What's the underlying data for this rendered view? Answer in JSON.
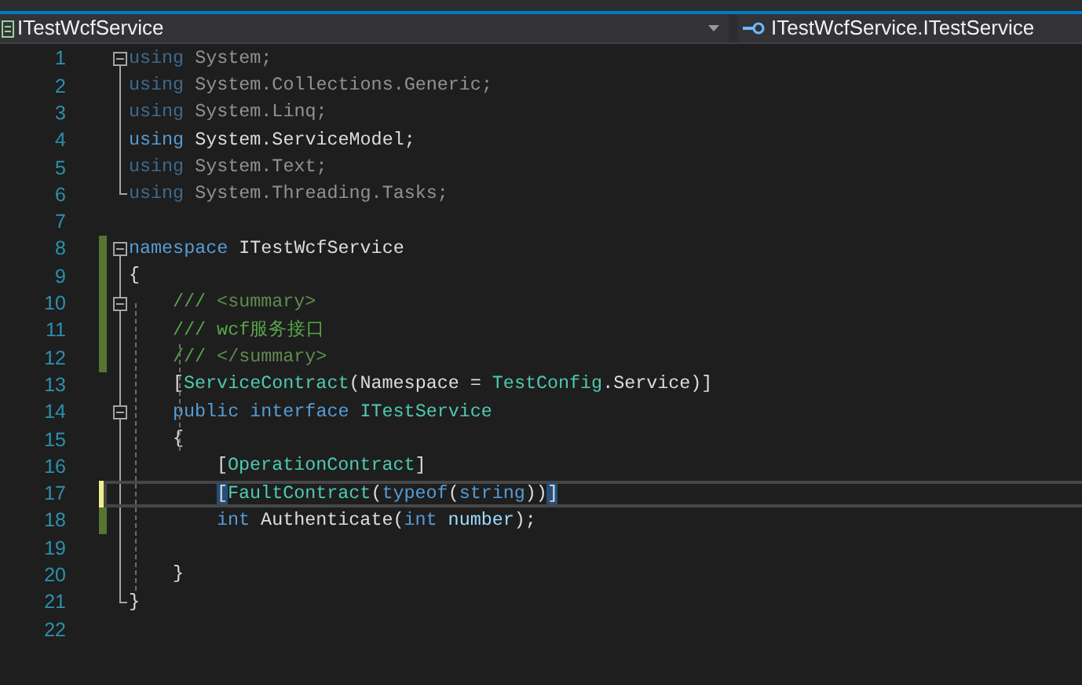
{
  "navigation_bar": {
    "project_dropdown": {
      "label": "ITestWcfService"
    },
    "member_dropdown": {
      "label": "ITestWcfService.ITestService"
    }
  },
  "editor": {
    "lines": [
      {
        "number": "1",
        "kind": "top",
        "modified": false,
        "fold_box": true,
        "outline": false,
        "outline_end": false,
        "unused": true,
        "current": false,
        "tokens": [
          {
            "text": "using",
            "kind": "keyword"
          },
          {
            "text": " System;",
            "kind": "plain"
          }
        ]
      },
      {
        "number": "2",
        "kind": "top",
        "modified": false,
        "fold_box": false,
        "outline": true,
        "outline_end": false,
        "unused": true,
        "current": false,
        "tokens": [
          {
            "text": "using",
            "kind": "keyword"
          },
          {
            "text": " System.Collections.Generic;",
            "kind": "plain"
          }
        ]
      },
      {
        "number": "3",
        "kind": "top",
        "modified": false,
        "fold_box": false,
        "outline": true,
        "outline_end": false,
        "unused": true,
        "current": false,
        "tokens": [
          {
            "text": "using",
            "kind": "keyword"
          },
          {
            "text": " System.Linq;",
            "kind": "plain"
          }
        ]
      },
      {
        "number": "4",
        "kind": "top",
        "modified": false,
        "fold_box": false,
        "outline": true,
        "outline_end": false,
        "unused": false,
        "current": false,
        "tokens": [
          {
            "text": "using",
            "kind": "keyword"
          },
          {
            "text": " System.ServiceModel;",
            "kind": "plain"
          }
        ]
      },
      {
        "number": "5",
        "kind": "top",
        "modified": false,
        "fold_box": false,
        "outline": true,
        "outline_end": false,
        "unused": true,
        "current": false,
        "tokens": [
          {
            "text": "using",
            "kind": "keyword"
          },
          {
            "text": " System.Text;",
            "kind": "plain"
          }
        ]
      },
      {
        "number": "6",
        "kind": "top",
        "modified": false,
        "fold_box": false,
        "outline": false,
        "outline_end": true,
        "unused": true,
        "current": false,
        "tokens": [
          {
            "text": "using",
            "kind": "keyword"
          },
          {
            "text": " System.Threading.Tasks;",
            "kind": "plain"
          }
        ]
      },
      {
        "number": "7",
        "modified": false,
        "fold_box": false,
        "outline": false,
        "outline_end": false,
        "current": false
      },
      {
        "number": "8",
        "kind": "top",
        "modified": true,
        "saved": true,
        "fold_box": true,
        "outline": false,
        "outline_end": false,
        "unused": false,
        "current": false,
        "tokens": [
          {
            "text": "namespace",
            "kind": "keyword"
          },
          {
            "text": " ITestWcfService",
            "kind": "plain"
          }
        ]
      },
      {
        "number": "9",
        "kind": "top",
        "modified": true,
        "saved": true,
        "fold_box": false,
        "outline": true,
        "outline_end": false,
        "unused": false,
        "current": false,
        "tokens": [
          {
            "text": "{",
            "kind": "plain"
          }
        ]
      },
      {
        "number": "10",
        "kind": "member",
        "modified": true,
        "saved": true,
        "fold_box": true,
        "outline": true,
        "outline_end": false,
        "unused": false,
        "current": false,
        "tokens": [
          {
            "text": "///",
            "kind": "comment"
          },
          {
            "text": " <summary>",
            "kind": "doc"
          }
        ]
      },
      {
        "number": "11",
        "kind": "member",
        "modified": true,
        "saved": true,
        "fold_box": false,
        "outline": true,
        "outline_end": false,
        "unused": false,
        "current": false,
        "tokens": [
          {
            "text": "/// wcf服务接口",
            "kind": "comment"
          }
        ]
      },
      {
        "number": "12",
        "kind": "member",
        "modified": true,
        "saved": true,
        "fold_box": false,
        "outline": true,
        "outline_end": false,
        "unused": false,
        "current": false,
        "tokens": [
          {
            "text": "///",
            "kind": "comment"
          },
          {
            "text": " </summary>",
            "kind": "doc"
          }
        ]
      },
      {
        "number": "13",
        "kind": "member",
        "modified": false,
        "fold_box": false,
        "outline": true,
        "outline_end": false,
        "unused": false,
        "current": false,
        "tokens": [
          {
            "text": "[",
            "kind": "plain"
          },
          {
            "text": "ServiceContract",
            "kind": "type"
          },
          {
            "text": "(Namespace = ",
            "kind": "plain"
          },
          {
            "text": "TestConfig",
            "kind": "type"
          },
          {
            "text": ".Service)]",
            "kind": "plain"
          }
        ]
      },
      {
        "number": "14",
        "kind": "member",
        "modified": false,
        "fold_box": true,
        "outline": true,
        "outline_end": false,
        "unused": false,
        "current": false,
        "tokens": [
          {
            "text": "public",
            "kind": "keyword"
          },
          {
            "text": " interface",
            "kind": "keyword"
          },
          {
            "text": " ITestService",
            "kind": "type"
          }
        ]
      },
      {
        "number": "15",
        "kind": "member",
        "modified": false,
        "fold_box": false,
        "outline": true,
        "outline_end": false,
        "unused": false,
        "current": false,
        "tokens": [
          {
            "text": "{",
            "kind": "plain"
          }
        ]
      },
      {
        "number": "16",
        "kind": "body",
        "modified": false,
        "fold_box": false,
        "outline": true,
        "outline_end": false,
        "unused": false,
        "current": false,
        "tokens": [
          {
            "text": "[",
            "kind": "plain"
          },
          {
            "text": "OperationContract",
            "kind": "type"
          },
          {
            "text": "]",
            "kind": "plain"
          }
        ]
      },
      {
        "number": "17",
        "kind": "body",
        "modified": true,
        "saved": false,
        "fold_box": false,
        "outline": true,
        "outline_end": false,
        "unused": false,
        "current": true,
        "tokens": [
          {
            "text": "[",
            "kind": "match"
          },
          {
            "text": "FaultContract",
            "kind": "type"
          },
          {
            "text": "(",
            "kind": "plain"
          },
          {
            "text": "typeof",
            "kind": "keyword"
          },
          {
            "text": "(",
            "kind": "plain"
          },
          {
            "text": "string",
            "kind": "keyword"
          },
          {
            "text": "))",
            "kind": "plain"
          },
          {
            "text": "]",
            "kind": "match"
          }
        ]
      },
      {
        "number": "18",
        "kind": "body",
        "modified": true,
        "saved": true,
        "fold_box": false,
        "outline": true,
        "outline_end": false,
        "unused": false,
        "current": false,
        "tokens": [
          {
            "text": "int",
            "kind": "keyword"
          },
          {
            "text": " Authenticate(",
            "kind": "plain"
          },
          {
            "text": "int",
            "kind": "keyword"
          },
          {
            "text": " number",
            "kind": "param"
          },
          {
            "text": ");",
            "kind": "plain"
          }
        ]
      },
      {
        "number": "19",
        "modified": false,
        "fold_box": false,
        "outline": true,
        "outline_end": false,
        "current": false
      },
      {
        "number": "20",
        "kind": "member",
        "modified": false,
        "fold_box": false,
        "outline": true,
        "outline_end": false,
        "unused": false,
        "current": false,
        "tokens": [
          {
            "text": "}",
            "kind": "plain"
          }
        ]
      },
      {
        "number": "21",
        "kind": "top",
        "modified": false,
        "fold_box": false,
        "outline": false,
        "outline_end": true,
        "unused": false,
        "current": false,
        "tokens": [
          {
            "text": "}",
            "kind": "plain"
          }
        ]
      },
      {
        "number": "22",
        "modified": false,
        "fold_box": false,
        "outline": false,
        "outline_end": false,
        "current": false
      }
    ]
  }
}
